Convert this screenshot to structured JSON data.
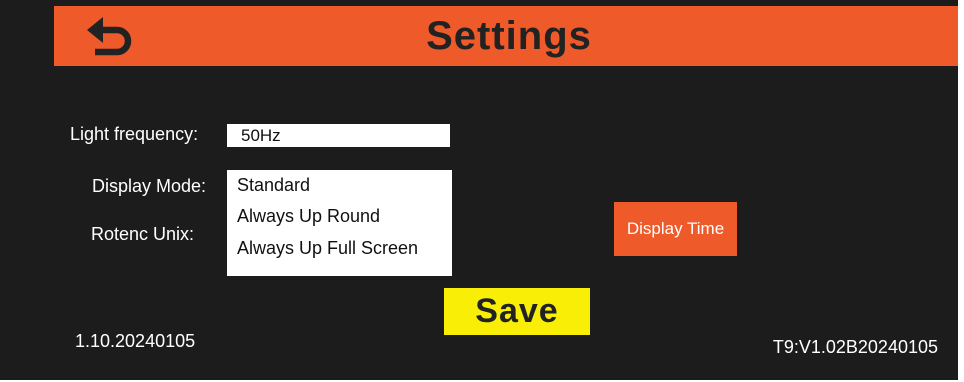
{
  "header": {
    "title": "Settings",
    "back_icon": "back-arrow-icon",
    "color": "#ee5a29"
  },
  "settings": {
    "light_frequency": {
      "label": "Light frequency:",
      "value": "50Hz"
    },
    "display_mode": {
      "label": "Display Mode:",
      "options": [
        "Standard",
        "Always Up Round",
        "Always Up Full Screen"
      ]
    },
    "rotenc_unix": {
      "label": "Rotenc Unix:"
    }
  },
  "buttons": {
    "display_time": "Display Time",
    "save": "Save",
    "save_color": "#f9ee05"
  },
  "footer": {
    "version_left": "1.10.20240105",
    "version_right": "T9:V1.02B20240105"
  }
}
